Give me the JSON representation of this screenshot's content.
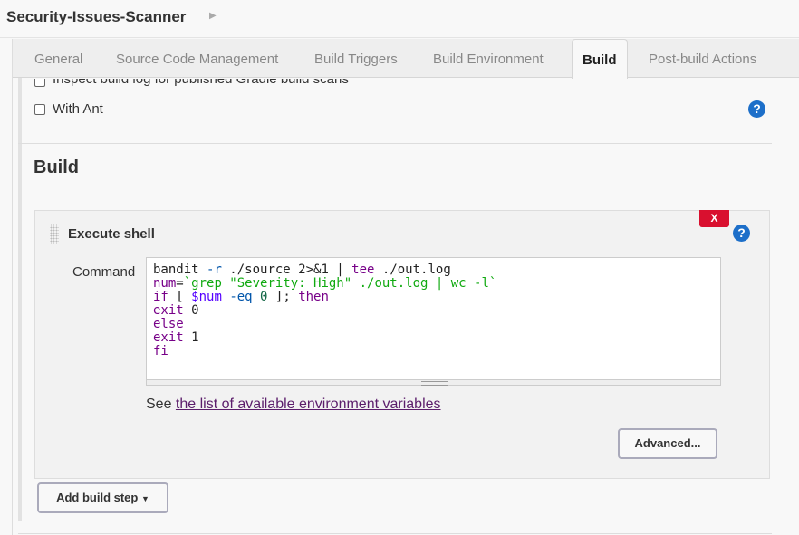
{
  "header": {
    "title": "Security-Issues-Scanner",
    "chevron_icon": "chevron-right-icon"
  },
  "tabs": [
    {
      "label": "General",
      "active": false
    },
    {
      "label": "Source Code Management",
      "active": false
    },
    {
      "label": "Build Triggers",
      "active": false
    },
    {
      "label": "Build Environment",
      "active": false
    },
    {
      "label": "Build",
      "active": true
    },
    {
      "label": "Post-build Actions",
      "active": false
    }
  ],
  "options": {
    "gradle_label": "Inspect build log for published Gradle build scans",
    "ant_label": "With Ant",
    "help": "?"
  },
  "section": {
    "title": "Build"
  },
  "step": {
    "title": "Execute shell",
    "delete_label": "X",
    "help": "?",
    "command_label": "Command",
    "code_lines": [
      [
        [
          "bandit ",
          ""
        ],
        [
          "-r",
          "op"
        ],
        [
          " ./source 2>&1 | ",
          ""
        ],
        [
          "tee",
          "kw"
        ],
        [
          " ./out.log",
          ""
        ]
      ],
      [
        [
          "num",
          "kw"
        ],
        [
          "=",
          ""
        ],
        [
          "`grep \"Severity: High\" ./out.log | wc -l`",
          "str"
        ]
      ],
      [
        [
          "if",
          "kw"
        ],
        [
          " [ ",
          ""
        ],
        [
          "$num",
          "var"
        ],
        [
          " ",
          ""
        ],
        [
          "-eq",
          "op"
        ],
        [
          " ",
          ""
        ],
        [
          "0",
          "num"
        ],
        [
          " ]; ",
          ""
        ],
        [
          "then",
          "kw"
        ]
      ],
      [
        [
          "exit",
          "kw"
        ],
        [
          " 0",
          ""
        ]
      ],
      [
        [
          "else",
          "kw"
        ]
      ],
      [
        [
          "exit",
          "kw"
        ],
        [
          " 1",
          ""
        ]
      ],
      [
        [
          "fi",
          "kw"
        ]
      ]
    ],
    "see_prefix": "See ",
    "see_link": "the list of available environment variables",
    "advanced_label": "Advanced..."
  },
  "add_step_label": "Add build step",
  "colors": {
    "keyword": "#770088",
    "string": "#11aa11",
    "delete": "#d9102f",
    "help": "#1d6fc9",
    "link": "#5b1d6b"
  }
}
